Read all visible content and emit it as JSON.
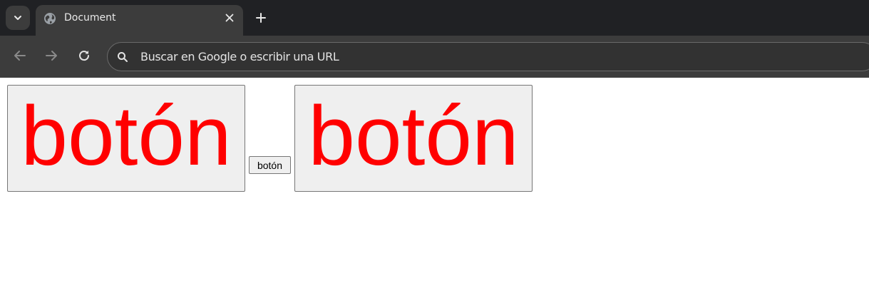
{
  "browser": {
    "tab": {
      "title": "Document",
      "favicon": "globe-icon"
    },
    "toolbar": {
      "back_icon": "arrow-left-icon",
      "forward_icon": "arrow-right-icon",
      "reload_icon": "reload-icon",
      "omnibox_placeholder": "Buscar en Google o escribir una URL",
      "omnibox_value": ""
    },
    "colors": {
      "tab_strip_bg": "#202124",
      "toolbar_bg": "#3c3c3c",
      "tab_text": "#e8e8e8"
    }
  },
  "page": {
    "buttons": [
      {
        "label": "botón",
        "size": "large",
        "text_color": "#ff0000"
      },
      {
        "label": "botón",
        "size": "small",
        "text_color": "#000000"
      },
      {
        "label": "botón",
        "size": "large",
        "text_color": "#ff0000"
      }
    ],
    "colors": {
      "button_bg": "#efefef",
      "button_border": "#767676",
      "accent_text": "#ff0000"
    }
  }
}
